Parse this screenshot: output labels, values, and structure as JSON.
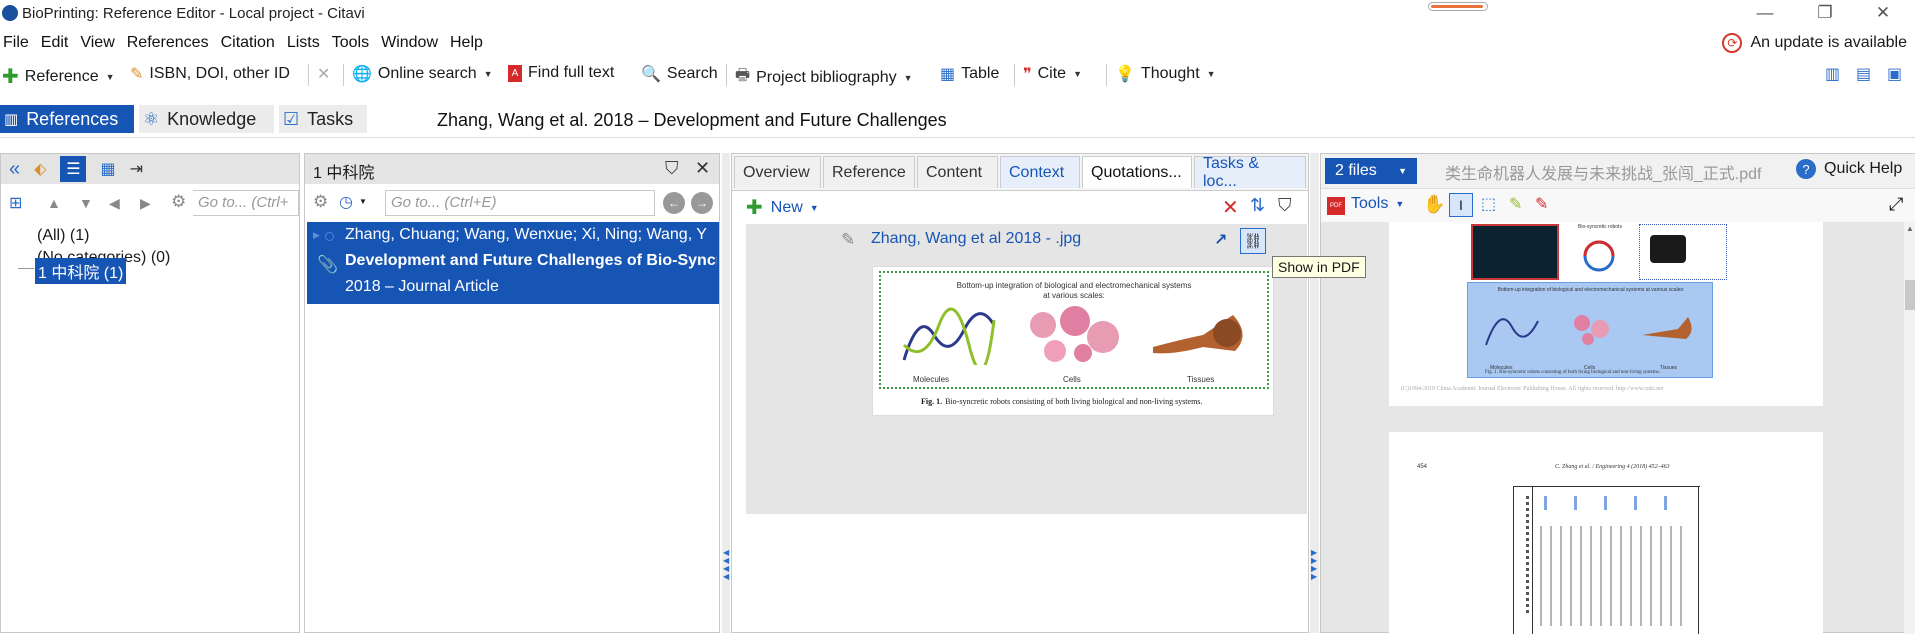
{
  "window": {
    "title": "BioPrinting: Reference Editor - Local project - Citavi",
    "controls": {
      "minimize": "—",
      "maximize": "❐",
      "close": "✕"
    }
  },
  "menu": {
    "items": [
      "File",
      "Edit",
      "View",
      "References",
      "Citation",
      "Lists",
      "Tools",
      "Window",
      "Help"
    ],
    "update_notice": "An update is available"
  },
  "toolbar": {
    "reference": "Reference",
    "isbn": "ISBN, DOI, other ID",
    "online_search": "Online search",
    "find_full_text": "Find full text",
    "search": "Search",
    "project_bibliography": "Project bibliography",
    "table": "Table",
    "cite": "Cite",
    "thought": "Thought"
  },
  "mode_tabs": [
    "References",
    "Knowledge",
    "Tasks"
  ],
  "document_title": "Zhang, Wang et al. 2018 – Development and Future Challenges",
  "left_panel": {
    "goto_placeholder": "Go to... (Ctrl+",
    "categories": [
      "(All) (1)",
      "(No categories) (0)"
    ],
    "group": "1 中科院 (1)"
  },
  "ref_list": {
    "header": "1 中科院",
    "goto_placeholder": "Go to... (Ctrl+E)",
    "items": [
      {
        "authors": "Zhang, Chuang; Wang, Wenxue; Xi, Ning; Wang, Y",
        "title": "Development and Future Challenges of Bio-Syncr",
        "meta": "2018 – Journal Article"
      }
    ]
  },
  "editor": {
    "tabs": [
      "Overview",
      "Reference",
      "Content",
      "Context",
      "Quotations...",
      "Tasks & loc..."
    ],
    "new_label": "New",
    "quotation_title": "Zhang, Wang et al 2018 - .jpg",
    "tooltip": "Show in PDF",
    "figure": {
      "heading_line1": "Bottom-up integration of biological and electromechanical systems",
      "heading_line2": "at various scales:",
      "labels": [
        "Molecules",
        "Cells",
        "Tissues"
      ],
      "caption_label": "Fig. 1.",
      "caption": "Bio-syncretic robots consisting of both living biological and non-living systems."
    }
  },
  "pdf": {
    "files_label": "2 files",
    "filename": "类生命机器人发展与未来挑战_张闯_正式.pdf",
    "quick_help": "Quick Help",
    "tools_label": "Tools",
    "pdf_badge": "PDF",
    "page1": {
      "heading": "Bottom-up integration of biological and electromechanical systems at various scales:",
      "robot_label": "Bio-syncretic robots",
      "labels": [
        "Molecules",
        "Cells",
        "Tissues"
      ],
      "caption": "Fig. 1.  Bio-syncretic robots consisting of both living biological and non-living systems.",
      "footer": "(C)1994-2019 China Academic Journal Electronic Publishing House. All rights reserved.    http://www.cnki.net"
    },
    "page2": {
      "page_number": "454",
      "running_head": "C. Zhang et al. / Engineering 4 (2018) 452–463"
    }
  },
  "colors": {
    "accent": "#1755b5",
    "tab_text_blue": "#1755b5",
    "update_red": "#d43a2a",
    "pdf_highlight": "#a9c9f3"
  },
  "icons": {
    "add": "green-plus-icon",
    "delete": "red-x-icon",
    "filter": "filter-icon",
    "link": "show-in-pdf-icon"
  }
}
